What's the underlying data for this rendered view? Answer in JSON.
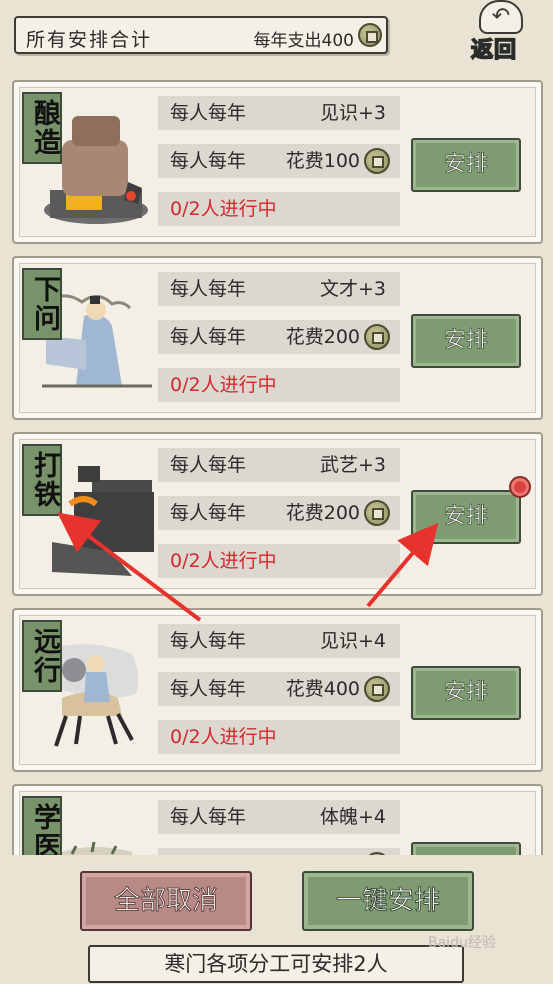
{
  "header": {
    "title": "所有安排合计",
    "cost_label": "每年支出400"
  },
  "back": {
    "label": "返回"
  },
  "cards": [
    {
      "tag": "酿造",
      "row1_label": "每人每年",
      "row1_value": "见识+3",
      "row2_label": "每人每年",
      "row2_value": "花费100",
      "status": "0/2人进行中",
      "button": "安排"
    },
    {
      "tag": "下问",
      "row1_label": "每人每年",
      "row1_value": "文才+3",
      "row2_label": "每人每年",
      "row2_value": "花费200",
      "status": "0/2人进行中",
      "button": "安排"
    },
    {
      "tag": "打铁",
      "row1_label": "每人每年",
      "row1_value": "武艺+3",
      "row2_label": "每人每年",
      "row2_value": "花费200",
      "status": "0/2人进行中",
      "button": "安排"
    },
    {
      "tag": "远行",
      "row1_label": "每人每年",
      "row1_value": "见识+4",
      "row2_label": "每人每年",
      "row2_value": "花费400",
      "status": "0/2人进行中",
      "button": "安排"
    },
    {
      "tag": "学医",
      "row1_label": "每人每年",
      "row1_value": "体魄+4",
      "row2_label": "",
      "row2_value": "",
      "status": "",
      "button": ""
    }
  ],
  "bottom": {
    "cancel_all": "全部取消",
    "auto_arrange": "一键安排",
    "note": "寒门各项分工可安排2人"
  },
  "watermark": "Baidu经验",
  "colors": {
    "accent_green": "#7f9b72",
    "cancel_red": "#b88a86",
    "status_red": "#d3282e",
    "annotation_arrow": "#e8322d"
  }
}
